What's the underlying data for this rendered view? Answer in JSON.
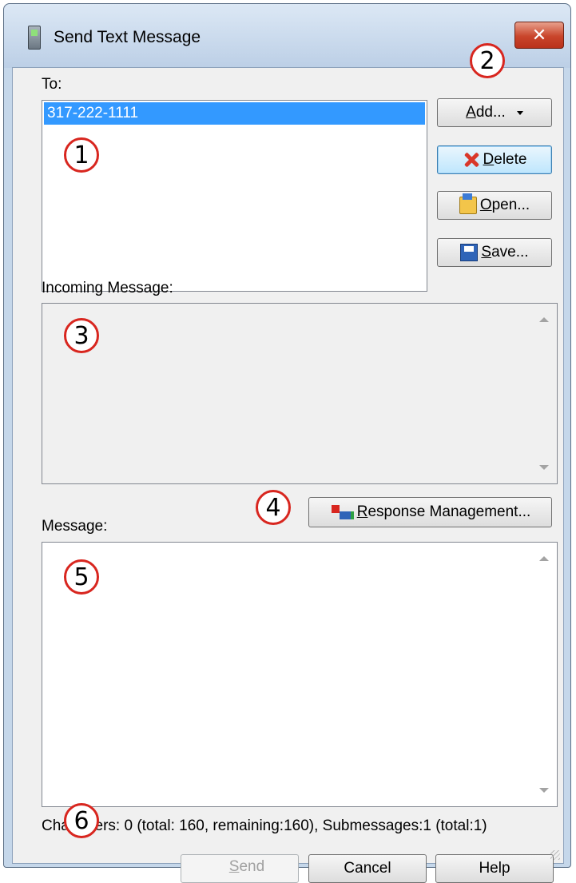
{
  "window": {
    "title": "Send Text Message",
    "close_glyph": "✕"
  },
  "to": {
    "label": "To:",
    "recipients": [
      "317-222-1111"
    ]
  },
  "buttons": {
    "add": {
      "underline": "A",
      "rest": "dd...",
      "icon": "chevron-down-icon"
    },
    "delete": {
      "underline": "D",
      "rest": "elete",
      "icon": "delete-x-icon"
    },
    "open": {
      "underline": "O",
      "rest": "pen...",
      "icon": "folder-open-icon"
    },
    "save": {
      "underline": "S",
      "rest": "ave...",
      "icon": "floppy-disk-icon"
    },
    "response": {
      "underline": "R",
      "rest": "esponse Management...",
      "icon": "response-management-icon"
    },
    "send": {
      "underline": "S",
      "rest": "end",
      "enabled": false
    },
    "cancel": {
      "label": "Cancel"
    },
    "help": {
      "label": "Help"
    }
  },
  "incoming": {
    "label": "Incoming Message:",
    "text": ""
  },
  "message": {
    "label": "Message:",
    "text": ""
  },
  "status": {
    "text": "Characters: 0 (total: 160, remaining:160), Submessages:1 (total:1)"
  },
  "callouts": [
    "1",
    "2",
    "3",
    "4",
    "5",
    "6"
  ],
  "colors": {
    "selection": "#3399ff",
    "callout_border": "#d8261f",
    "close_button": "#c9452b"
  }
}
